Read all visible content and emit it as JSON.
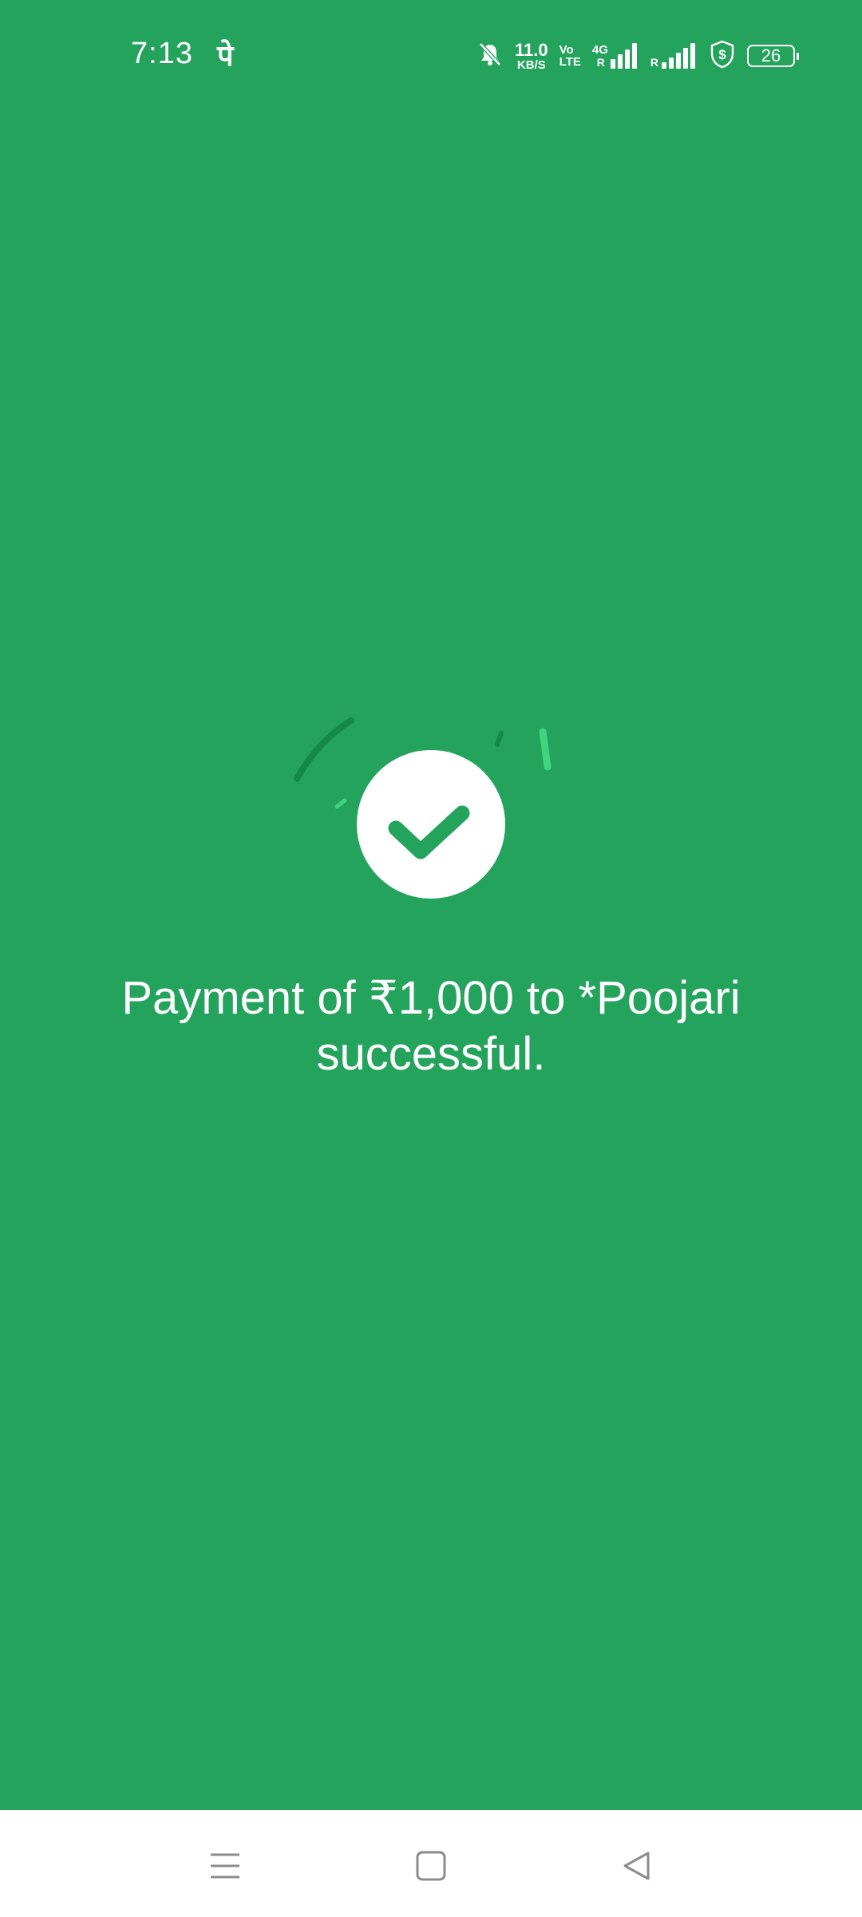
{
  "status_bar": {
    "time": "7:13",
    "app_indicator": "पे",
    "net_speed_value": "11.0",
    "net_speed_unit": "KB/S",
    "volte_top": "Vo",
    "volte_bottom": "LTE",
    "network_type": "4G",
    "roaming_1": "R",
    "roaming_2": "R",
    "battery_level": "26",
    "icons": [
      "bell-muted-icon",
      "signal-icon",
      "signal-icon",
      "shield-dollar-icon",
      "battery-icon"
    ]
  },
  "success": {
    "message": "Payment of ₹1,000 to *Poojari successful.",
    "icon": "checkmark-icon"
  },
  "nav_bar": {
    "icons": [
      "menu-icon",
      "home-icon",
      "back-icon"
    ]
  },
  "colors": {
    "background": "#23a35c",
    "accent_dark": "#148a45",
    "accent_light": "#3ed57e",
    "nav_bar": "#ffffff",
    "nav_icon": "#8c8c8c"
  }
}
